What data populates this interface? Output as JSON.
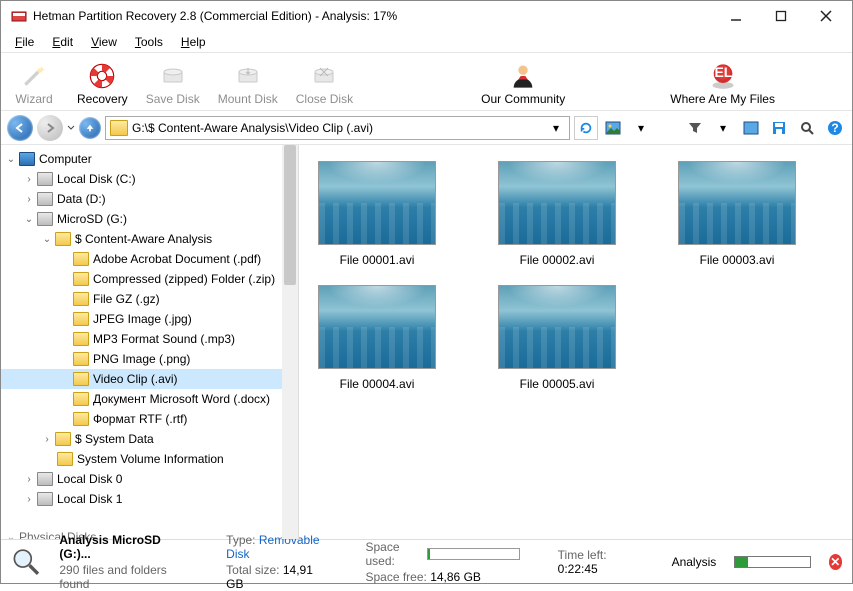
{
  "window": {
    "title": "Hetman Partition Recovery 2.8 (Commercial Edition) - Analysis: 17%"
  },
  "menu": {
    "file": "File",
    "edit": "Edit",
    "view": "View",
    "tools": "Tools",
    "help": "Help"
  },
  "toolbar": {
    "wizard": "Wizard",
    "recovery": "Recovery",
    "save_disk": "Save Disk",
    "mount_disk": "Mount Disk",
    "close_disk": "Close Disk",
    "community": "Our Community",
    "where_files": "Where Are My Files"
  },
  "address": {
    "path": "G:\\$ Content-Aware Analysis\\Video Clip (.avi)"
  },
  "tree": {
    "computer": "Computer",
    "local_c": "Local Disk (C:)",
    "data_d": "Data (D:)",
    "microsd": "MicroSD (G:)",
    "content_aware": "$ Content-Aware Analysis",
    "pdf": "Adobe Acrobat Document (.pdf)",
    "zip": "Compressed (zipped) Folder (.zip)",
    "gz": "File GZ (.gz)",
    "jpg": "JPEG Image (.jpg)",
    "mp3": "MP3 Format Sound (.mp3)",
    "png": "PNG Image (.png)",
    "avi": "Video Clip (.avi)",
    "docx": "Документ Microsoft Word (.docx)",
    "rtf": "Формат RTF (.rtf)",
    "system_data": "$ System Data",
    "svi": "System Volume Information",
    "local0": "Local Disk 0",
    "local1": "Local Disk 1",
    "physical": "Physical Disks"
  },
  "files": [
    {
      "name": "File 00001.avi"
    },
    {
      "name": "File 00002.avi"
    },
    {
      "name": "File 00003.avi"
    },
    {
      "name": "File 00004.avi"
    },
    {
      "name": "File 00005.avi"
    }
  ],
  "status": {
    "analysis_title": "Analysis MicroSD (G:)...",
    "files_found": "290 files and folders found",
    "type_label": "Type:",
    "type_value": "Removable Disk",
    "total_label": "Total size:",
    "total_value": "14,91 GB",
    "used_label": "Space used:",
    "free_label": "Space free:",
    "free_value": "14,86 GB",
    "time_label": "Time left:",
    "time_value": "0:22:45",
    "analysis_label": "Analysis",
    "used_percent": 2
  }
}
